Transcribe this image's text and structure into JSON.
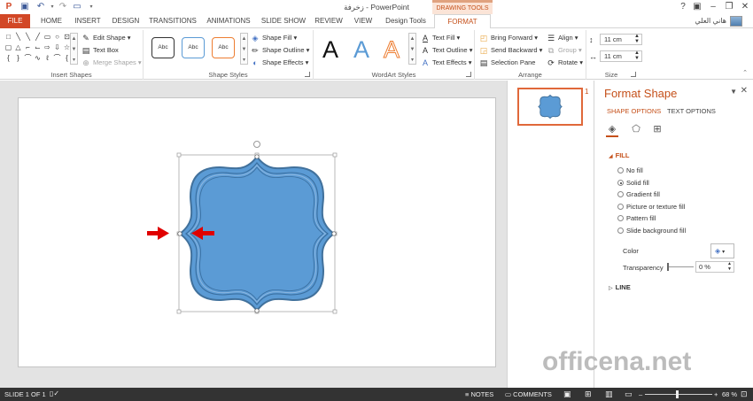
{
  "window": {
    "title": "زخرفة - PowerPoint",
    "context_group": "DRAWING TOOLS",
    "user_name": "هاني العلي",
    "help": "?"
  },
  "tabs": [
    "FILE",
    "HOME",
    "INSERT",
    "DESIGN",
    "TRANSITIONS",
    "ANIMATIONS",
    "SLIDE SHOW",
    "REVIEW",
    "VIEW",
    "Design Tools",
    "FORMAT"
  ],
  "ribbon": {
    "insert_shapes": {
      "label": "Insert Shapes",
      "edit_shape": "Edit Shape",
      "text_box": "Text Box",
      "merge_shapes": "Merge Shapes"
    },
    "shape_styles": {
      "label": "Shape Styles",
      "thumb_text": "Abc",
      "shape_fill": "Shape Fill",
      "shape_outline": "Shape Outline",
      "shape_effects": "Shape Effects"
    },
    "wordart_styles": {
      "label": "WordArt Styles",
      "sample": "A",
      "text_fill": "Text Fill",
      "text_outline": "Text Outline",
      "text_effects": "Text Effects"
    },
    "arrange": {
      "label": "Arrange",
      "bring_forward": "Bring Forward",
      "send_backward": "Send Backward",
      "selection_pane": "Selection Pane",
      "align": "Align",
      "group": "Group",
      "rotate": "Rotate"
    },
    "size": {
      "label": "Size",
      "height": "11 cm",
      "width": "11 cm"
    }
  },
  "thumbnails": {
    "slide_number": "1"
  },
  "format_pane": {
    "title": "Format Shape",
    "tabs": [
      "SHAPE OPTIONS",
      "TEXT OPTIONS"
    ],
    "fill_section": "FILL",
    "fill_options": [
      "No fill",
      "Solid fill",
      "Gradient fill",
      "Picture or texture fill",
      "Pattern fill",
      "Slide background fill"
    ],
    "selected_fill": "Solid fill",
    "color_label": "Color",
    "transparency_label": "Transparency",
    "transparency_value": "0 %",
    "line_section": "LINE"
  },
  "statusbar": {
    "slide_info": "SLIDE 1 OF 1",
    "notes": "NOTES",
    "comments": "COMMENTS",
    "zoom": "68 %"
  },
  "watermark": "officena.net",
  "colors": {
    "accent": "#c5501a",
    "file_tab": "#d24726",
    "shape_fill": "#5b9bd5",
    "shape_outline": "#41719c",
    "arrows": "#e00000"
  }
}
